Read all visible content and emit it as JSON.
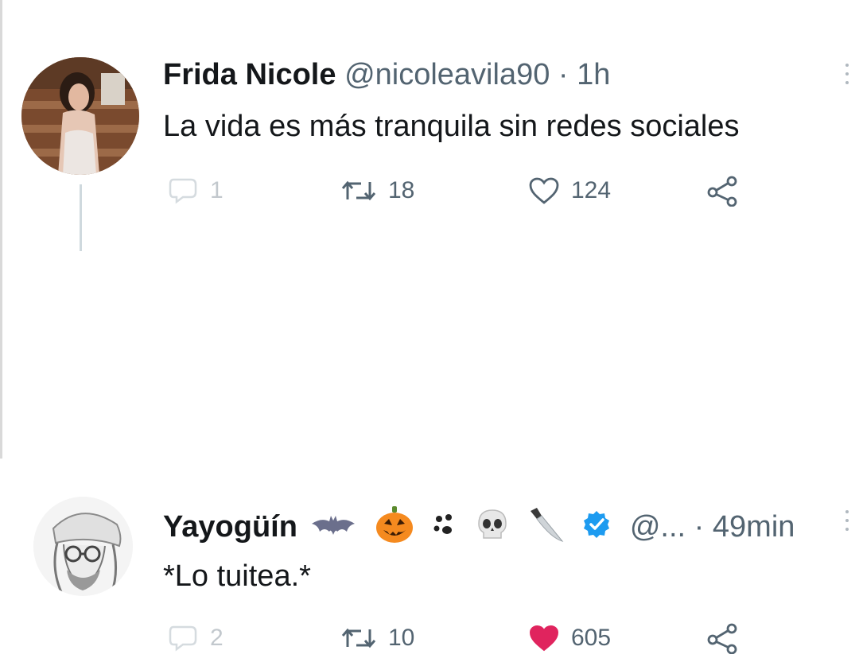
{
  "tweets": [
    {
      "display_name": "Frida Nicole",
      "handle": "@nicoleavila90",
      "separator": "·",
      "time": "1h",
      "emojis": [],
      "text": "La vida es más tranquila sin redes sociales",
      "reply_count": "1",
      "retweet_count": "18",
      "like_count": "124",
      "liked": false
    },
    {
      "display_name": "Yayogüín",
      "handle": "@...",
      "separator": "·",
      "time": "49min",
      "emojis": [
        "bat",
        "jack-o-lantern",
        "paw-prints",
        "skull",
        "knife",
        "verified-badge"
      ],
      "text": "*Lo tuitea.*",
      "reply_count": "2",
      "retweet_count": "10",
      "like_count": "605",
      "liked": true
    }
  ],
  "colors": {
    "text": "#14171a",
    "secondary": "#536471",
    "like_red": "#e0245e",
    "verified_blue": "#1d9bf0",
    "thread_line": "#cfd9de"
  }
}
